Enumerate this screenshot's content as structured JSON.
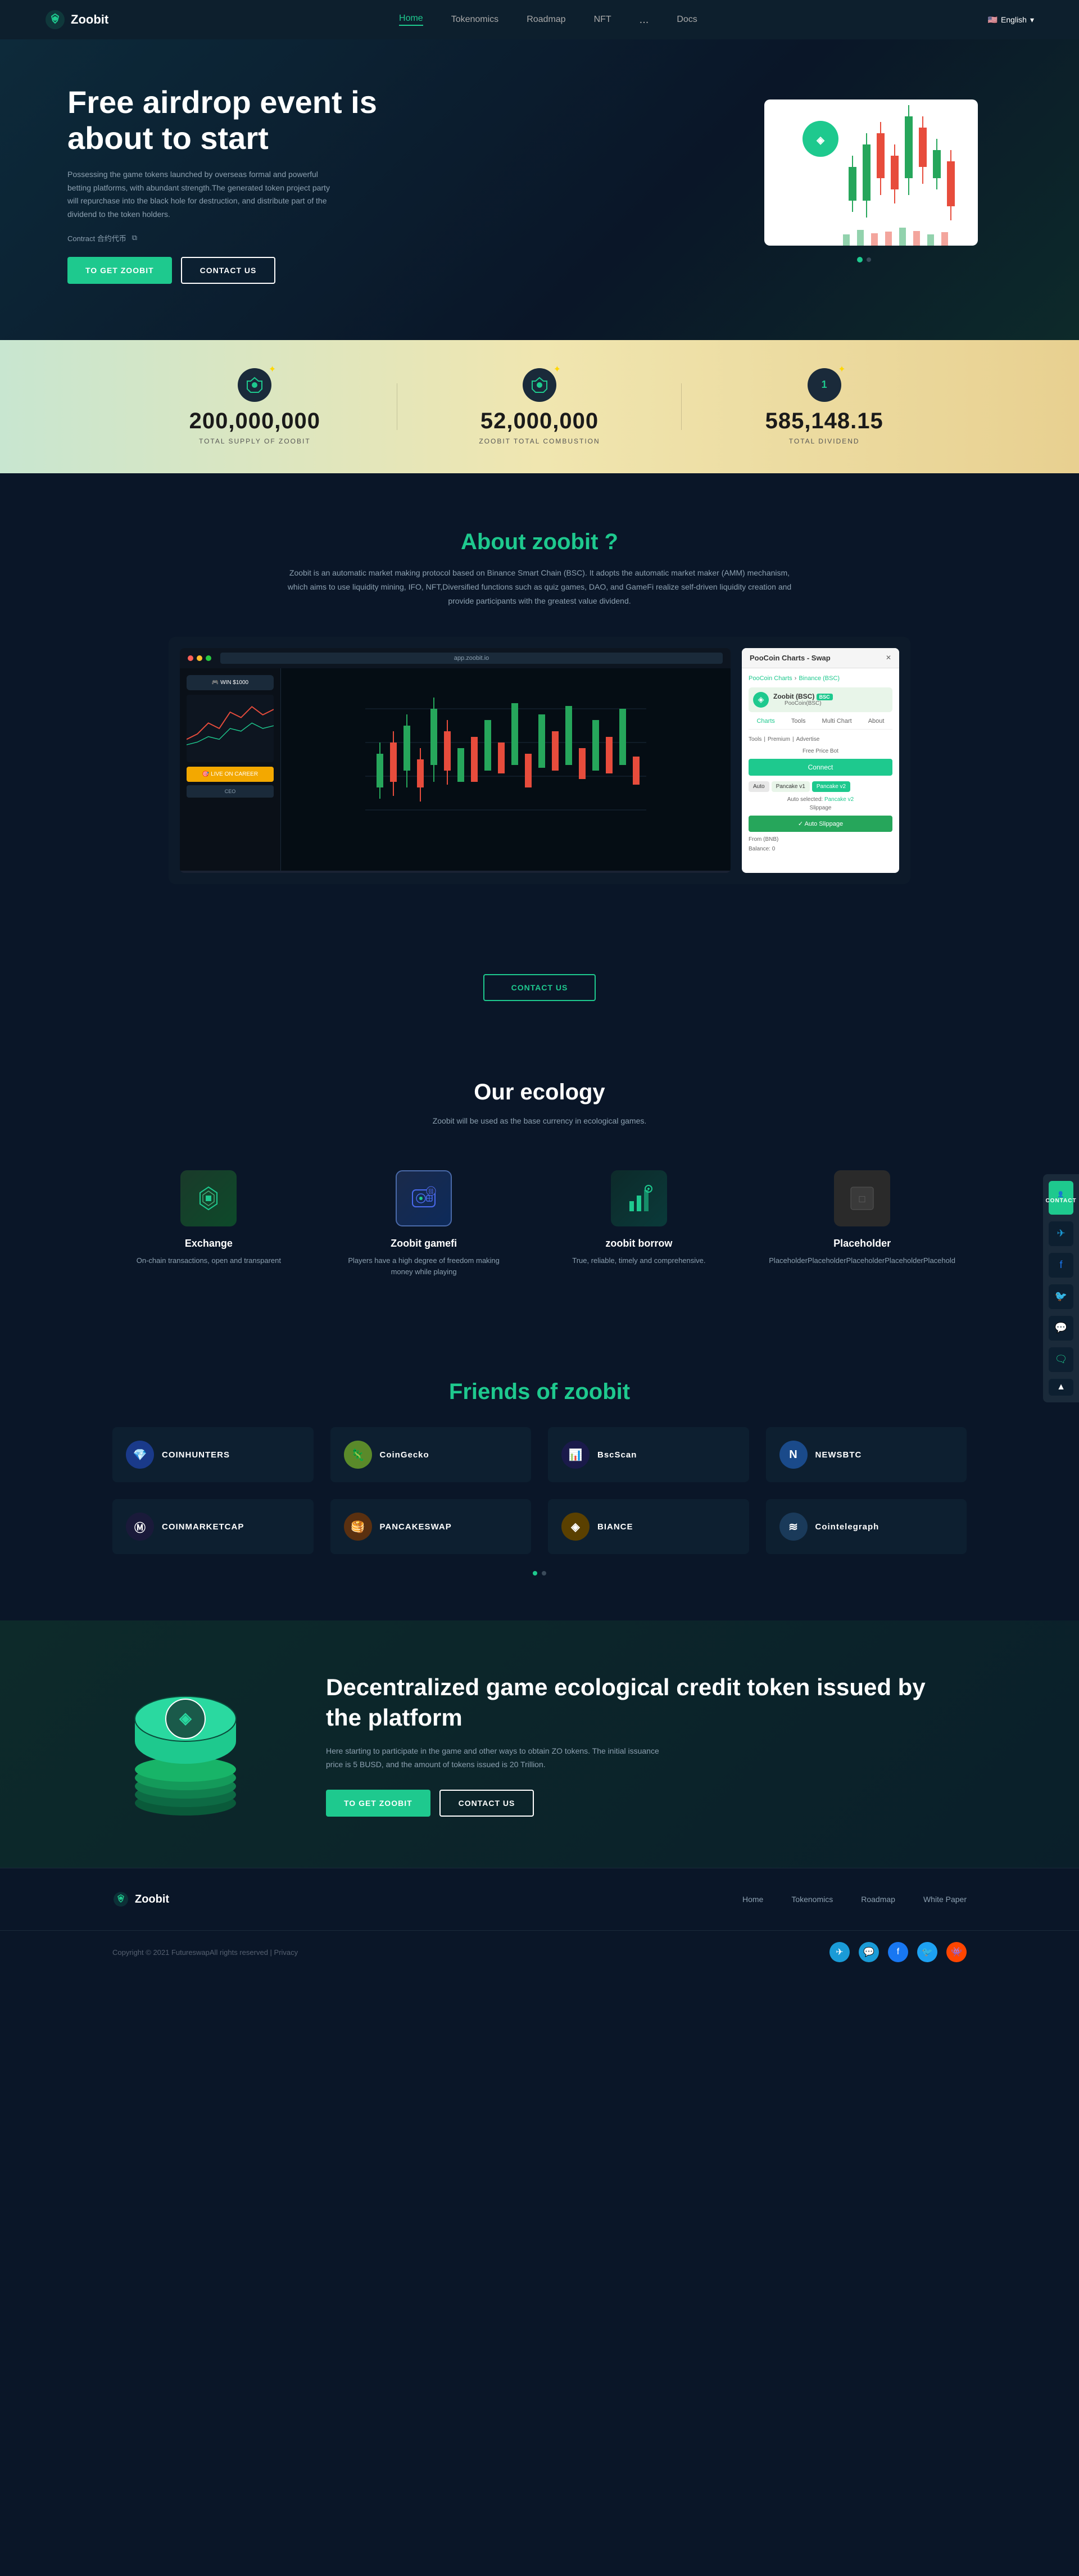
{
  "brand": {
    "name": "Zoobit",
    "logo_symbol": "◈"
  },
  "nav": {
    "links": [
      {
        "label": "Home",
        "active": true
      },
      {
        "label": "Tokenomics",
        "active": false
      },
      {
        "label": "Roadmap",
        "active": false
      },
      {
        "label": "NFT",
        "active": false
      },
      {
        "label": "...",
        "active": false
      },
      {
        "label": "Docs",
        "active": false
      }
    ],
    "lang": "English"
  },
  "hero": {
    "title": "Free airdrop event is about to start",
    "description": "Possessing the game tokens launched by overseas formal and powerful betting platforms, with abundant strength.The generated token project party will repurchase into the black hole for destruction, and distribute part of the dividend to the token holders.",
    "contract_label": "Contract 合约代币",
    "btn_get": "TO GET ZOOBIT",
    "btn_contact": "CONTACT US"
  },
  "stats": [
    {
      "number": "200,000,000",
      "label": "TOTAL SUPPLY OF ZOOBIT",
      "icon": "⬡"
    },
    {
      "number": "52,000,000",
      "label": "ZOOBIT TOTAL COMBUSTION",
      "icon": "⬡"
    },
    {
      "number": "585,148.15",
      "label": "TOTAL DIVIDEND",
      "icon": "1"
    }
  ],
  "about": {
    "title": "About",
    "title_highlight": "zoobit",
    "title_suffix": " ?",
    "description": "Zoobit is an automatic market making protocol based on Binance Smart Chain (BSC). It adopts the automatic market maker (AMM) mechanism, which aims to use liquidity mining, IFO, NFT,Diversified functions such as quiz games, DAO, and GameFi realize self-driven liquidity creation and provide participants with the greatest value dividend."
  },
  "contact_us_btn": "CONTACT US",
  "ecology": {
    "title": "Our ecology",
    "subtitle": "Zoobit will be used as the base currency in ecological games.",
    "cards": [
      {
        "name": "Exchange",
        "desc": "On-chain transactions, open and transparent",
        "icon": "⬡"
      },
      {
        "name": "Zoobit gamefi",
        "desc": "Players have a high degree of freedom making money while playing",
        "icon": "🎮"
      },
      {
        "name": "zoobit borrow",
        "desc": "True, reliable, timely and comprehensive.",
        "icon": "📊"
      },
      {
        "name": "Placeholder",
        "desc": "PlaceholderPlaceholderPlaceholderPlaceholderPlacehold",
        "icon": "□"
      }
    ]
  },
  "friends": {
    "title": "Friends of",
    "title_highlight": "zoobit",
    "partners": [
      {
        "name": "COINHUNTERS",
        "color": "#3a7bd5",
        "symbol": "💎"
      },
      {
        "name": "CoinGecko",
        "color": "#8bc34a",
        "symbol": "🦎"
      },
      {
        "name": "BscScan",
        "color": "#1a2a5a",
        "symbol": "📊"
      },
      {
        "name": "NEWSBTC",
        "color": "#1a5aaa",
        "symbol": "N"
      },
      {
        "name": "COINMARKETCAP",
        "color": "#1a1a3a",
        "symbol": "Ⓜ"
      },
      {
        "name": "PANCAKESWAP",
        "color": "#d2691e",
        "symbol": "🥞"
      },
      {
        "name": "BIANCE",
        "color": "#f3a800",
        "symbol": "◈"
      },
      {
        "name": "Cointelegraph",
        "color": "#2a4a6a",
        "symbol": "≋"
      }
    ]
  },
  "cta": {
    "title": "Decentralized game ecological credit token issued by the platform",
    "description": "Here starting to participate in the game and other ways to obtain ZO tokens. The initial issuance price is 5 BUSD, and the amount of tokens issued is 20 Trillion.",
    "btn_get": "TO GET ZOOBIT",
    "btn_contact": "CONTACT US"
  },
  "footer": {
    "links": [
      "Home",
      "Tokenomics",
      "Roadmap",
      "White Paper"
    ],
    "copyright": "Copyright © 2021 FutureswapAll rights reserved  |  Privacy"
  },
  "float_sidebar": {
    "contact_label": "CONTACT",
    "items": [
      "telegram",
      "facebook",
      "twitter",
      "discord",
      "chat"
    ]
  }
}
